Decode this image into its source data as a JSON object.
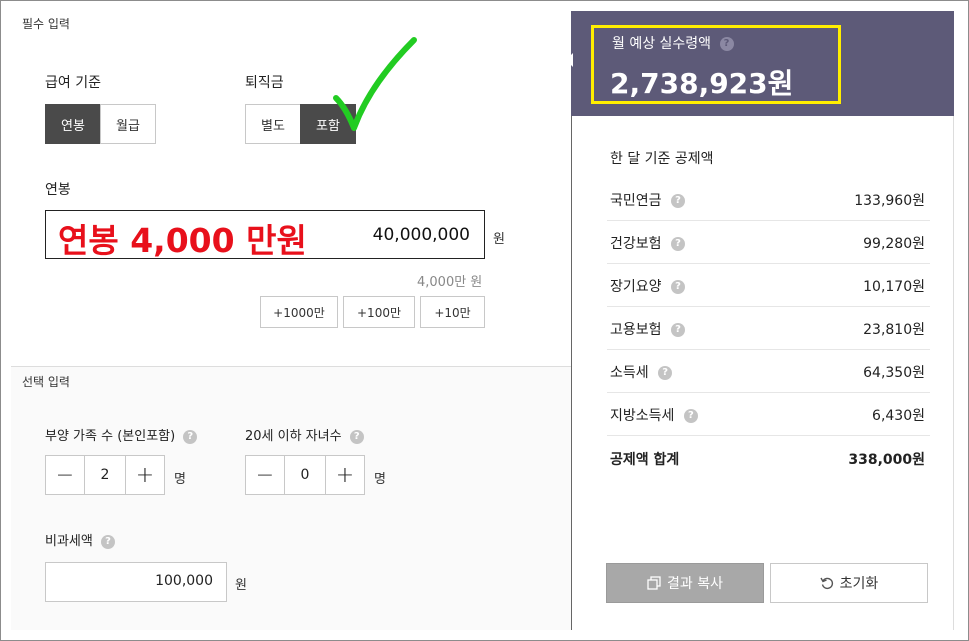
{
  "required_section": {
    "title": "필수 입력"
  },
  "salary_basis": {
    "label": "급여 기준",
    "options": [
      "연봉",
      "월급"
    ],
    "selected": "연봉"
  },
  "severance": {
    "label": "퇴직금",
    "options": [
      "별도",
      "포함"
    ],
    "selected": "포함"
  },
  "annual_salary": {
    "label": "연봉",
    "overlay_text": "연봉 4,000 만원",
    "value": "40,000,000",
    "unit": "원",
    "summary": "4,000만 원",
    "quick_add": [
      "+1000만",
      "+100만",
      "+10만"
    ]
  },
  "optional_section": {
    "title": "선택 입력"
  },
  "dependents": {
    "label": "부양 가족 수 (본인포함)",
    "value": "2",
    "unit": "명",
    "minus": "−",
    "plus": "+"
  },
  "children": {
    "label": "20세 이하 자녀수",
    "value": "0",
    "unit": "명",
    "minus": "−",
    "plus": "+"
  },
  "nontaxable": {
    "label": "비과세액",
    "value": "100,000",
    "unit": "원"
  },
  "help_glyph": "?",
  "result": {
    "label": "월 예상 실수령액",
    "value": "2,738,923원"
  },
  "deductions": {
    "title": "한 달 기준 공제액",
    "rows": [
      {
        "name": "국민연금",
        "value": "133,960원"
      },
      {
        "name": "건강보험",
        "value": "99,280원"
      },
      {
        "name": "장기요양",
        "value": "10,170원"
      },
      {
        "name": "고용보험",
        "value": "23,810원"
      },
      {
        "name": "소득세",
        "value": "64,350원"
      },
      {
        "name": "지방소득세",
        "value": "6,430원"
      }
    ],
    "total_label": "공제액 합계",
    "total_value": "338,000원"
  },
  "actions": {
    "copy_label": "결과 복사",
    "reset_label": "초기화"
  },
  "colors": {
    "header_bg": "#5d5a78",
    "highlight_border": "#ffee00",
    "overlay_red": "#e8101b",
    "checkmark": "#22cc22",
    "selected_bg": "#4a4a4a"
  }
}
